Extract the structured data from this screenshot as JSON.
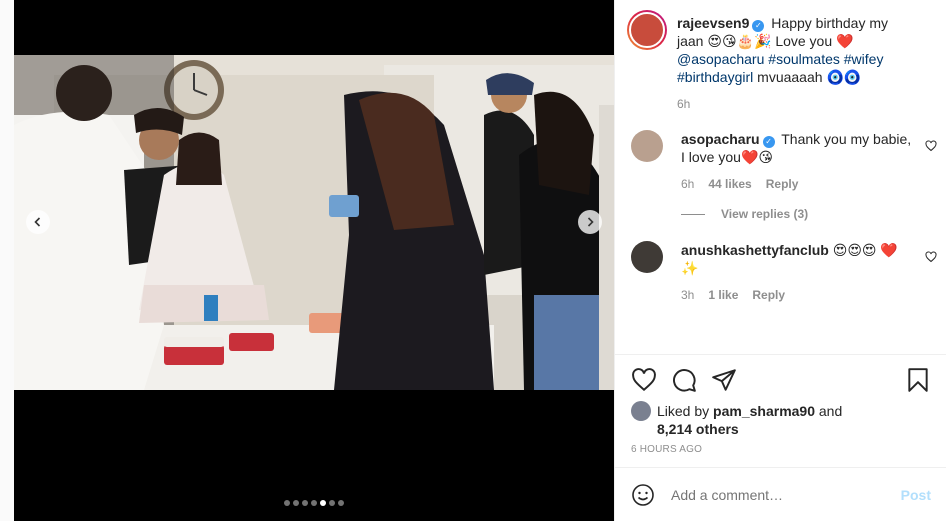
{
  "media": {
    "prev_icon": "chevron-left-icon",
    "next_icon": "chevron-right-icon",
    "slide_count": 7,
    "active_slide": 5
  },
  "caption": {
    "username": "rajeevsen9",
    "text_1": "Happy birthday my jaan",
    "emoji_1": "😍😘🎂🎉",
    "text_2": "Love you",
    "emoji_2": "❤️",
    "mention": "@asopacharu",
    "hashtags": "#soulmates #wifey #birthdaygirl",
    "text_3": "mvuaaaah",
    "emoji_3": "🧿🧿",
    "time": "6h"
  },
  "comments": [
    {
      "username": "asopacharu",
      "text": "Thank you my babie, I love you",
      "emoji": "❤️😘",
      "time": "6h",
      "likes": "44 likes",
      "reply_label": "Reply",
      "view_replies": "View replies (3)"
    },
    {
      "username": "anushkashettyfanclub",
      "emoji": "😍😍😍",
      "emoji_2": "❤️✨",
      "time": "3h",
      "likes": "1 like",
      "reply_label": "Reply"
    }
  ],
  "actions": {
    "liked_prefix": "Liked by",
    "liked_user": "pam_sharma90",
    "liked_and": "and",
    "liked_others": "8,214 others",
    "ago": "6 HOURS AGO"
  },
  "add_comment": {
    "placeholder": "Add a comment…",
    "post_label": "Post"
  },
  "colors": {
    "link": "#00376b",
    "verified": "#3897f0",
    "muted": "#8e8e8e",
    "post_disabled": "#b2dffc"
  }
}
